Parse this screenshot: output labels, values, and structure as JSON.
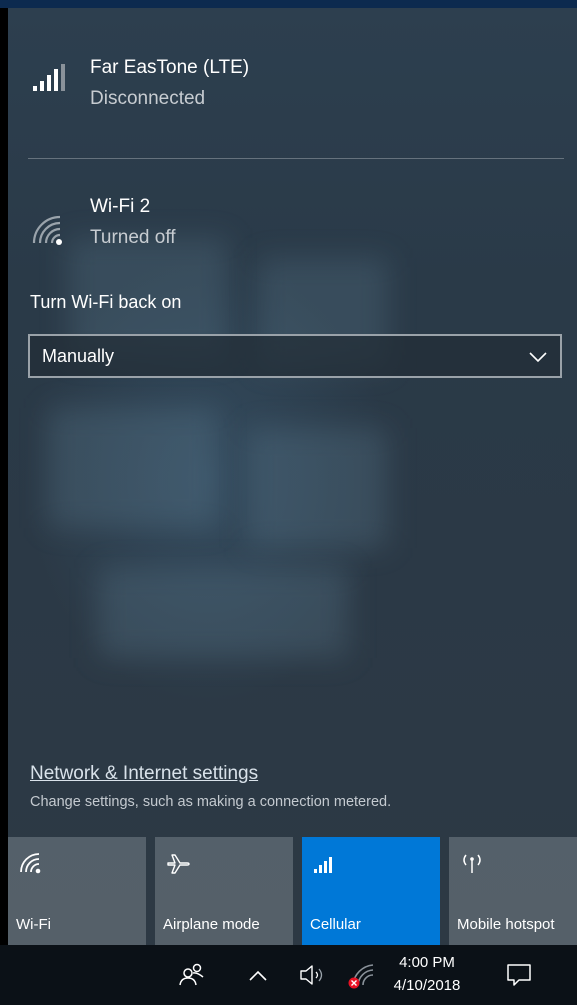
{
  "networks": [
    {
      "name": "Far EasTone (LTE)",
      "status": "Disconnected",
      "icon": "cellular-signal-icon"
    },
    {
      "name": "Wi-Fi 2",
      "status": "Turned off",
      "icon": "wifi-off-icon"
    }
  ],
  "wifi_back_on": {
    "label": "Turn Wi-Fi back on",
    "selected": "Manually"
  },
  "settings": {
    "link": "Network & Internet settings",
    "description": "Change settings, such as making a connection metered."
  },
  "quick_actions": [
    {
      "label": "Wi-Fi",
      "icon": "wifi-icon",
      "active": false
    },
    {
      "label": "Airplane mode",
      "icon": "airplane-icon",
      "active": false
    },
    {
      "label": "Cellular",
      "icon": "cellular-icon",
      "active": true
    },
    {
      "label": "Mobile hotspot",
      "icon": "hotspot-icon",
      "active": false
    }
  ],
  "taskbar": {
    "time": "4:00 PM",
    "date": "4/10/2018"
  },
  "colors": {
    "accent": "#0078d7",
    "flyout_bg": "#2b3946",
    "taskbar_bg": "#0b1117",
    "error": "#e81123"
  }
}
